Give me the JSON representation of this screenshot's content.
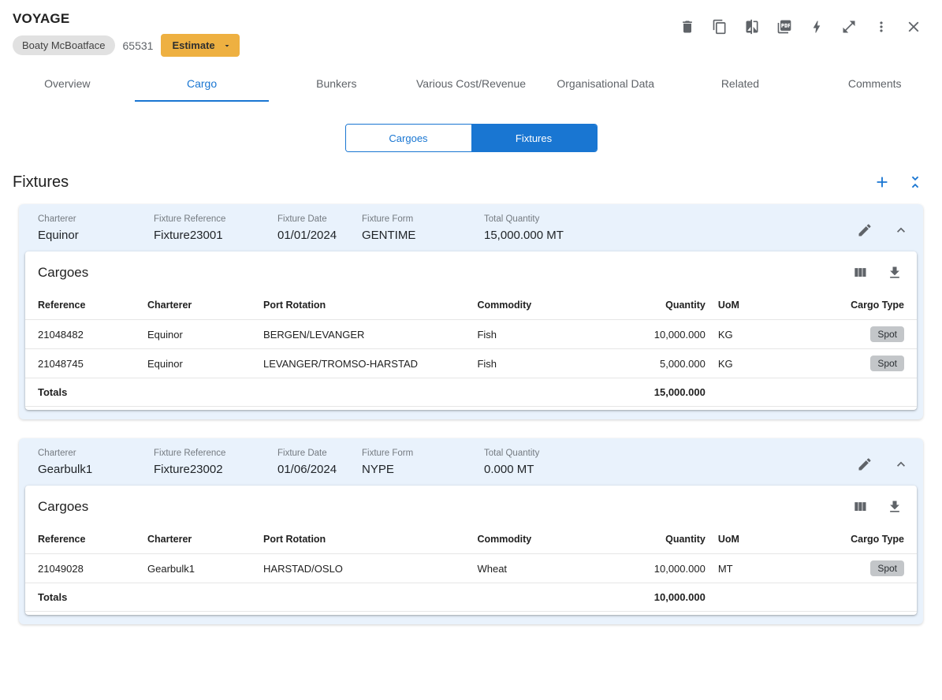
{
  "colors": {
    "accent_blue": "#1976d2",
    "estimate_yellow": "#eeb041",
    "fixture_header_bg": "#e9f2fc",
    "badge_gray": "#c3c6c9"
  },
  "header": {
    "title": "VOYAGE",
    "vessel_chip": "Boaty McBoatface",
    "voyage_number": "65531",
    "estimate_label": "Estimate",
    "icons": [
      "delete-icon",
      "copy-icon",
      "compare-icon",
      "pdf-icon",
      "bolt-icon",
      "expand-icon",
      "more-vert-icon",
      "close-icon"
    ]
  },
  "tabs": [
    "Overview",
    "Cargo",
    "Bunkers",
    "Various Cost/Revenue",
    "Organisational Data",
    "Related",
    "Comments"
  ],
  "active_tab": "Cargo",
  "toggle": {
    "cargoes": "Cargoes",
    "fixtures": "Fixtures",
    "active": "Fixtures"
  },
  "section": {
    "title": "Fixtures"
  },
  "field_labels": {
    "charterer": "Charterer",
    "fixture_reference": "Fixture Reference",
    "fixture_date": "Fixture Date",
    "fixture_form": "Fixture Form",
    "total_quantity": "Total Quantity"
  },
  "cargoes_card": {
    "title": "Cargoes",
    "columns": [
      "Reference",
      "Charterer",
      "Port Rotation",
      "Commodity",
      "Quantity",
      "UoM",
      "Cargo Type"
    ],
    "totals_label": "Totals"
  },
  "fixtures": [
    {
      "charterer": "Equinor",
      "fixture_reference": "Fixture23001",
      "fixture_date": "01/01/2024",
      "fixture_form": "GENTIME",
      "total_quantity": "15,000.000 MT",
      "rows": [
        {
          "reference": "21048482",
          "charterer": "Equinor",
          "port_rotation": "BERGEN/LEVANGER",
          "commodity": "Fish",
          "quantity": "10,000.000",
          "uom": "KG",
          "cargo_type": "Spot"
        },
        {
          "reference": "21048745",
          "charterer": "Equinor",
          "port_rotation": "LEVANGER/TROMSO-HARSTAD",
          "commodity": "Fish",
          "quantity": "5,000.000",
          "uom": "KG",
          "cargo_type": "Spot"
        }
      ],
      "totals_quantity": "15,000.000"
    },
    {
      "charterer": "Gearbulk1",
      "fixture_reference": "Fixture23002",
      "fixture_date": "01/06/2024",
      "fixture_form": "NYPE",
      "total_quantity": "0.000 MT",
      "rows": [
        {
          "reference": "21049028",
          "charterer": "Gearbulk1",
          "port_rotation": "HARSTAD/OSLO",
          "commodity": "Wheat",
          "quantity": "10,000.000",
          "uom": "MT",
          "cargo_type": "Spot"
        }
      ],
      "totals_quantity": "10,000.000"
    }
  ]
}
